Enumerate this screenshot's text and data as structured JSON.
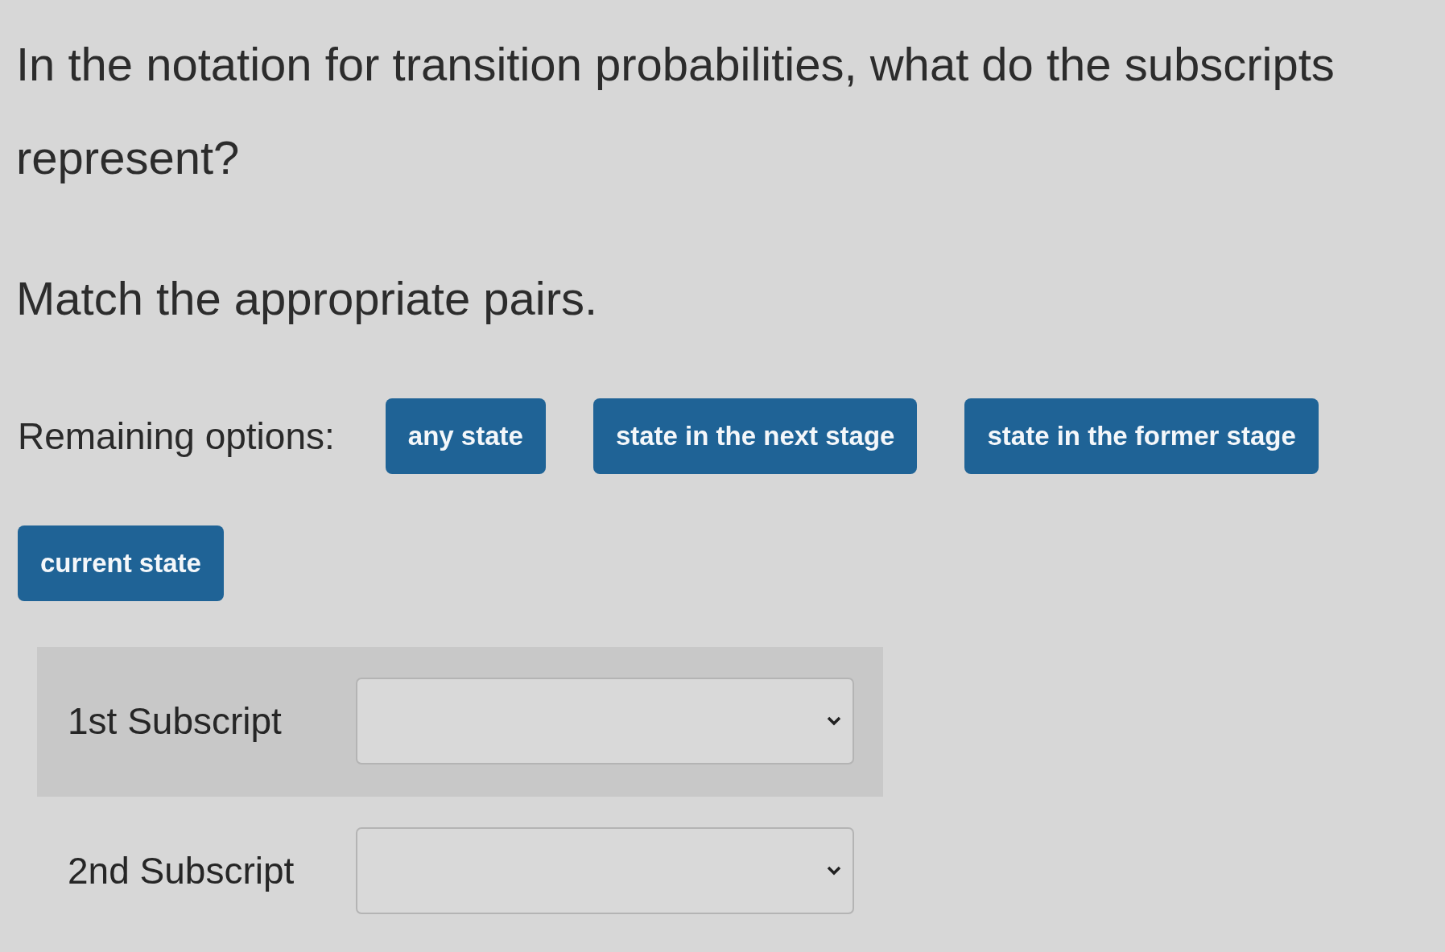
{
  "question": {
    "prompt": "In the notation for transition probabilities, what do the subscripts represent?",
    "instruction": "Match the appropriate pairs."
  },
  "options": {
    "label": "Remaining options:",
    "items": [
      "any state",
      "state in the next stage",
      "state in the former stage",
      "current state"
    ]
  },
  "matches": [
    {
      "label": "1st Subscript",
      "highlighted": true
    },
    {
      "label": "2nd Subscript",
      "highlighted": false
    }
  ]
}
